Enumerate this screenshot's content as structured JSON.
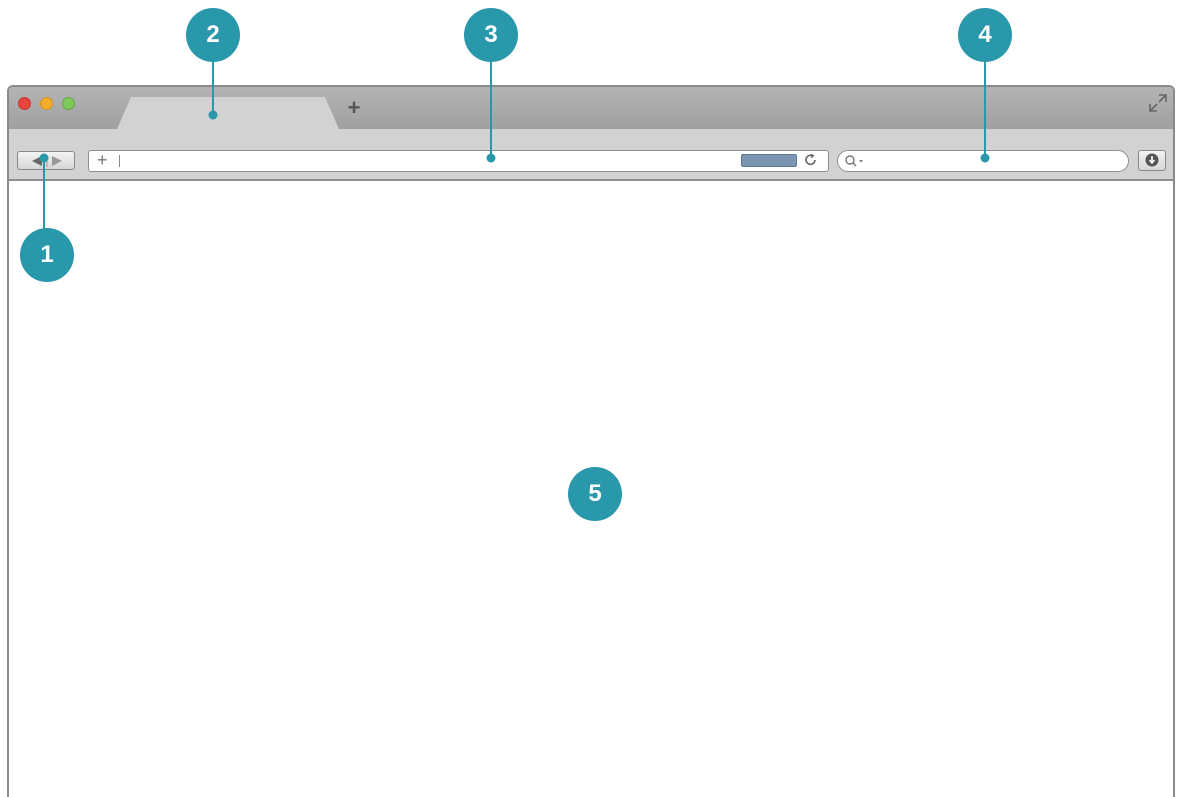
{
  "callouts": [
    {
      "label": "1",
      "target": "back-forward-buttons"
    },
    {
      "label": "2",
      "target": "browser-tab"
    },
    {
      "label": "3",
      "target": "address-bar"
    },
    {
      "label": "4",
      "target": "search-bar"
    },
    {
      "label": "5",
      "target": "content-area"
    }
  ],
  "address_bar": {
    "plus_glyph": "+"
  },
  "tab_bar": {
    "new_tab_glyph": "+"
  },
  "icons": {
    "close": "red-close-icon",
    "minimize": "yellow-minimize-icon",
    "zoom": "green-zoom-icon",
    "fullscreen": "fullscreen-icon",
    "navigation": "back-forward-icon",
    "reload": "reload-icon",
    "search": "search-icon",
    "download": "download-icon"
  },
  "colors": {
    "callout": "#2a98ab",
    "close": "#e8433d",
    "minimize": "#f3ad2e",
    "zoom": "#7ec75b"
  }
}
